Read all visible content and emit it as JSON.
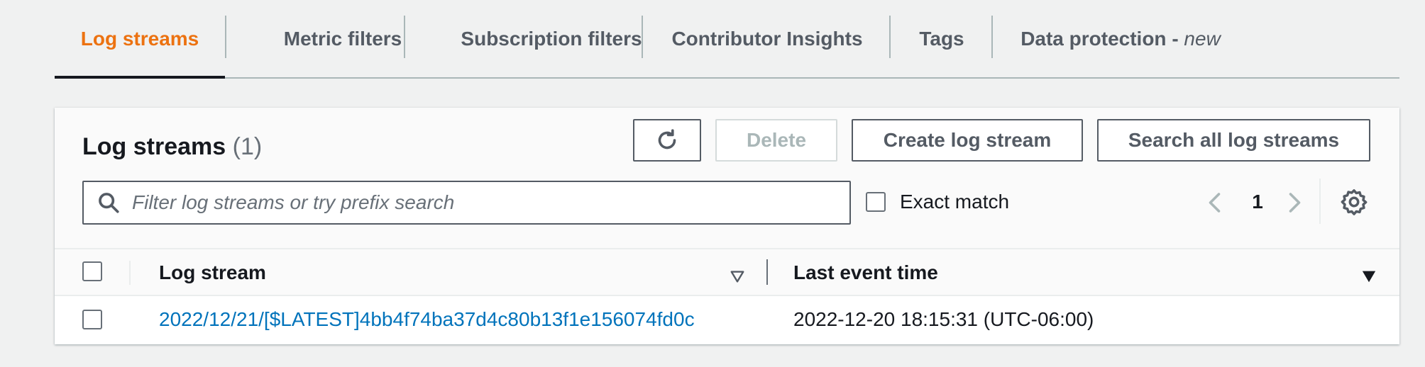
{
  "tabs": [
    {
      "label": "Log streams",
      "active": true
    },
    {
      "label": "Metric filters"
    },
    {
      "label": "Subscription filters"
    },
    {
      "label": "Contributor Insights"
    },
    {
      "label": "Tags"
    },
    {
      "label": "Data protection - ",
      "suffix": "new"
    }
  ],
  "panel": {
    "title": "Log streams",
    "count": "(1)",
    "buttons": {
      "refresh_icon": "refresh-icon",
      "delete": "Delete",
      "create": "Create log stream",
      "search_all": "Search all log streams"
    },
    "search": {
      "placeholder": "Filter log streams or try prefix search",
      "value": ""
    },
    "exact_match_label": "Exact match",
    "exact_match_checked": false,
    "pagination": {
      "current_page": "1"
    }
  },
  "table": {
    "columns": [
      "Log stream",
      "Last event time"
    ],
    "rows": [
      {
        "log_stream": "2022/12/21/[$LATEST]4bb4f74ba37d4c80b13f1e156074fd0c",
        "last_event_time": "2022-12-20 18:15:31 (UTC-06:00)"
      }
    ]
  },
  "colors": {
    "active_tab": "#ec7211",
    "link": "#0073bb",
    "text": "#16191f",
    "secondary_text": "#545b64"
  }
}
